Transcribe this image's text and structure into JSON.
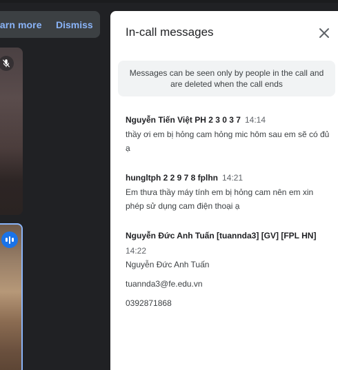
{
  "banner": {
    "learn_more": "earn more",
    "dismiss": "Dismiss"
  },
  "panel": {
    "title": "In-call messages",
    "info": "Messages can be seen only by people in the call and are deleted when the call ends"
  },
  "messages": [
    {
      "sender": "Nguyễn Tiến Việt PH 2 3 0 3 7",
      "time": "14:14",
      "text": "thầy ơi em bị hỏng cam hỏng mic hôm sau em sẽ có đủ ạ"
    },
    {
      "sender": "hungltph 2 2 9 7 8 fplhn",
      "time": "14:21",
      "text": "Em thưa thầy máy tính em bị hỏng cam nên em xin phép sử dụng cam điện thoại ạ"
    },
    {
      "sender": "Nguyễn Đức Anh Tuấn [tuannda3] [GV] [FPL HN]",
      "time": "14:22",
      "lines": [
        "Nguyễn Đức Anh Tuấn",
        "tuannda3@fe.edu.vn",
        "0392871868"
      ]
    }
  ],
  "icons": {
    "close": "close-icon",
    "mic_off": "mic-off-icon",
    "speaking": "speaking-indicator-icon"
  }
}
